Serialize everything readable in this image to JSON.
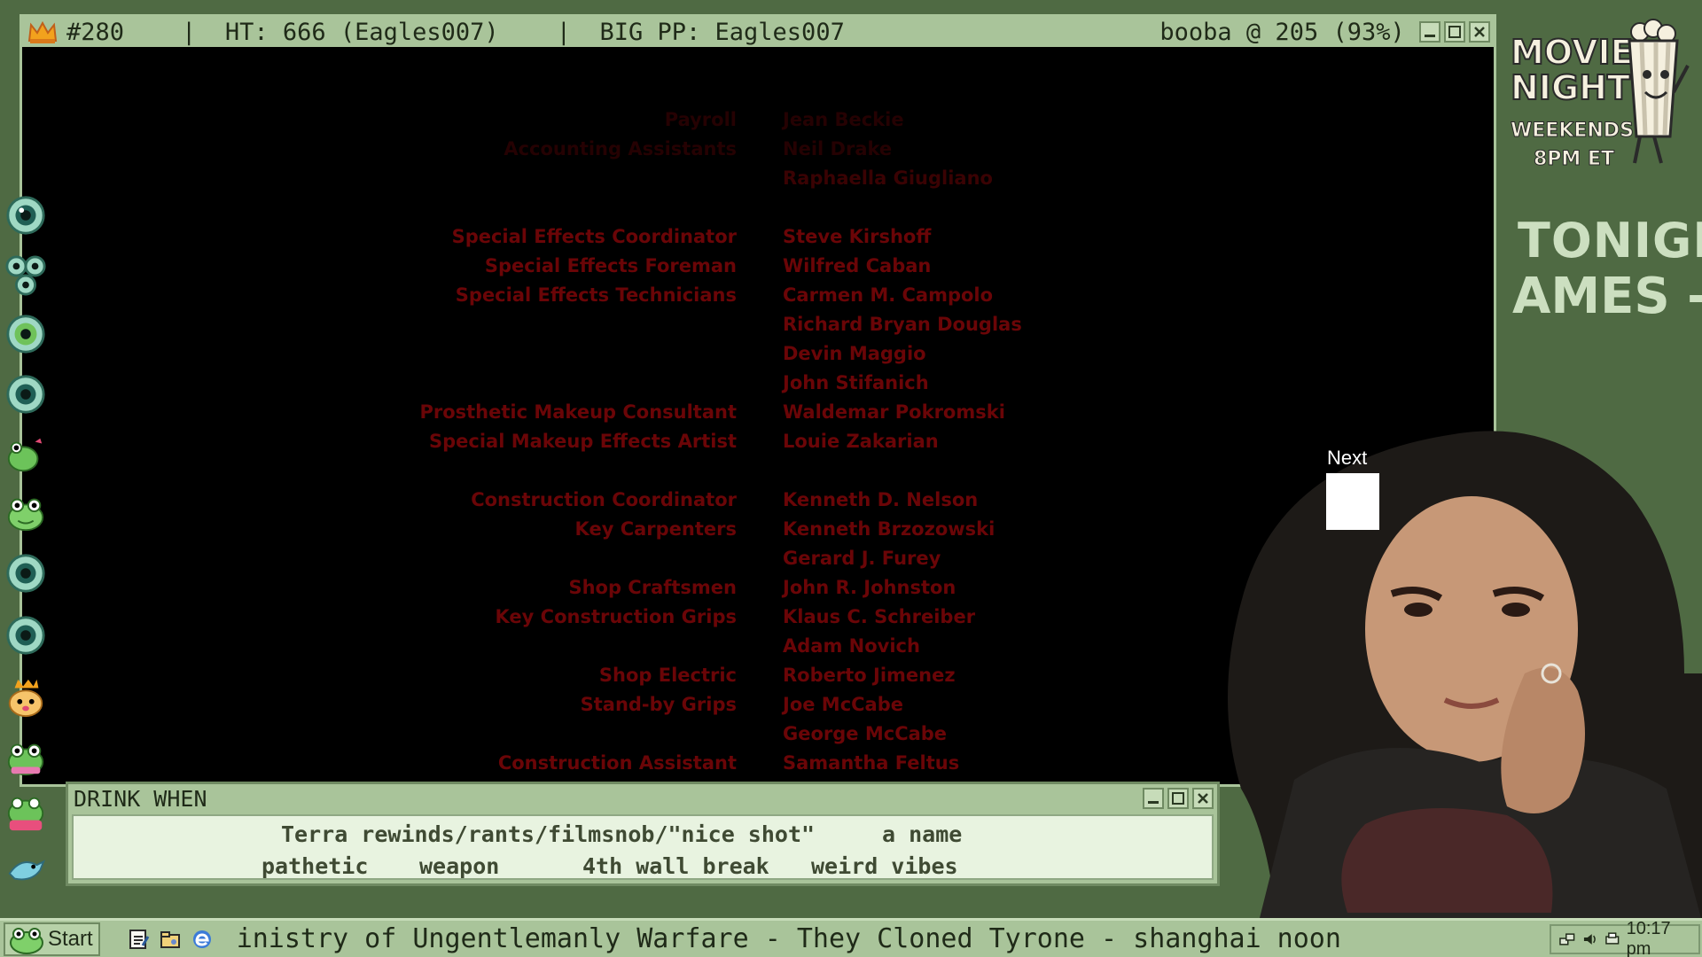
{
  "main_window": {
    "title_number": "#280",
    "title_ht": "HT: 666 (Eagles007)",
    "title_bigpp": "BIG PP: Eagles007",
    "title_status": "booba @ 205 (93%)"
  },
  "credits": [
    {
      "role": "Payroll",
      "name": "Jean Beckie"
    },
    {
      "role": "Accounting Assistants",
      "name": "Neil Drake"
    },
    {
      "role": "",
      "name": "Raphaella Giugliano"
    },
    {
      "role": "Special Effects Coordinator",
      "name": "Steve Kirshoff"
    },
    {
      "role": "Special Effects Foreman",
      "name": "Wilfred Caban"
    },
    {
      "role": "Special Effects Technicians",
      "name": "Carmen M. Campolo"
    },
    {
      "role": "",
      "name": "Richard Bryan Douglas"
    },
    {
      "role": "",
      "name": "Devin Maggio"
    },
    {
      "role": "",
      "name": "John Stifanich"
    },
    {
      "role": "Prosthetic Makeup Consultant",
      "name": "Waldemar Pokromski"
    },
    {
      "role": "Special Makeup Effects Artist",
      "name": "Louie Zakarian"
    },
    {
      "role": "Construction Coordinator",
      "name": "Kenneth D. Nelson"
    },
    {
      "role": "Key Carpenters",
      "name": "Kenneth Brzozowski"
    },
    {
      "role": "",
      "name": "Gerard J. Furey"
    },
    {
      "role": "Shop Craftsmen",
      "name": "John R. Johnston"
    },
    {
      "role": "Key Construction Grips",
      "name": "Klaus C. Schreiber"
    },
    {
      "role": "",
      "name": "Adam Novich"
    },
    {
      "role": "Shop Electric",
      "name": "Roberto Jimenez"
    },
    {
      "role": "Stand-by Grips",
      "name": "Joe McCabe"
    },
    {
      "role": "",
      "name": "George McCabe"
    },
    {
      "role": "Construction Assistant",
      "name": "Samantha Feltus"
    }
  ],
  "drink_window": {
    "title": "DRINK WHEN",
    "rules": [
      "Terra rewinds/rants/filmsnob/\"nice shot\"",
      "a name",
      "pathetic",
      "weapon",
      "4th wall break",
      "weird vibes"
    ]
  },
  "right_panel": {
    "logo_line1": "MOVIE",
    "logo_line2": "NIGHT",
    "logo_line3": "WEEKENDS",
    "logo_line4": "8PM ET",
    "tonight": "TONIGHT:",
    "tonight_sub": "AMES -",
    "next_label": "Next"
  },
  "taskbar": {
    "start_label": "Start",
    "ticker": "inistry of Ungentlemanly Warfare - They Cloned Tyrone - shanghai noon",
    "clock": "10:17 pm"
  },
  "colors": {
    "frame": "#a9c49a",
    "background": "#4f6a43",
    "credits_red": "#6a0507"
  },
  "icons": {
    "emotes": [
      "eyeball-emote-icon",
      "triple-eyes-emote-icon",
      "eyeball-emote-icon",
      "eyeball-emote-icon",
      "frog-kiss-emote-icon",
      "frog-emote-icon",
      "eyeball-emote-icon",
      "eyeball-emote-icon",
      "crowned-cat-emote-icon",
      "frog-hug-emote-icon",
      "frog-pink-emote-icon",
      "bird-emote-icon"
    ]
  }
}
